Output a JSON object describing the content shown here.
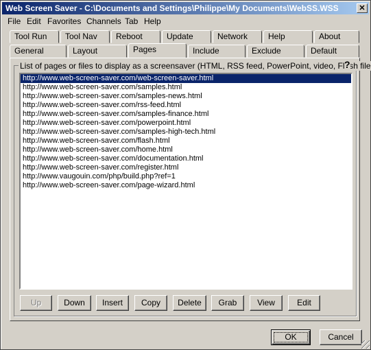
{
  "window": {
    "title": "Web Screen Saver - C:\\Documents and Settings\\Philippe\\My Documents\\WebSS.WSS",
    "close_glyph": "✕"
  },
  "menu": [
    "File",
    "Edit",
    "Favorites",
    "Channels",
    "Tab",
    "Help"
  ],
  "tabs_row1": [
    "Tool Run",
    "Tool Nav",
    "Reboot",
    "Update",
    "Network",
    "Help",
    "About"
  ],
  "tabs_row2": [
    "General",
    "Layout",
    "Pages",
    "Include",
    "Exclude",
    "Default"
  ],
  "active_tab": "Pages",
  "group": {
    "label": "List of pages or files to display as a screensaver (HTML, RSS feed, PowerPoint, video, Flash file...)",
    "help_glyph": "?"
  },
  "pages": [
    "http://www.web-screen-saver.com/web-screen-saver.html",
    "http://www.web-screen-saver.com/samples.html",
    "http://www.web-screen-saver.com/samples-news.html",
    "http://www.web-screen-saver.com/rss-feed.html",
    "http://www.web-screen-saver.com/samples-finance.html",
    "http://www.web-screen-saver.com/powerpoint.html",
    "http://www.web-screen-saver.com/samples-high-tech.html",
    "http://www.web-screen-saver.com/flash.html",
    "http://www.web-screen-saver.com/home.html",
    "http://www.web-screen-saver.com/documentation.html",
    "http://www.web-screen-saver.com/register.html",
    "http://www.vaugouin.com/php/build.php?ref=1",
    "http://www.web-screen-saver.com/page-wizard.html"
  ],
  "selected_index": 0,
  "list_buttons": [
    "Up",
    "Down",
    "Insert",
    "Copy",
    "Delete",
    "Grab",
    "View",
    "Edit"
  ],
  "dialog_buttons": {
    "ok": "OK",
    "cancel": "Cancel"
  }
}
